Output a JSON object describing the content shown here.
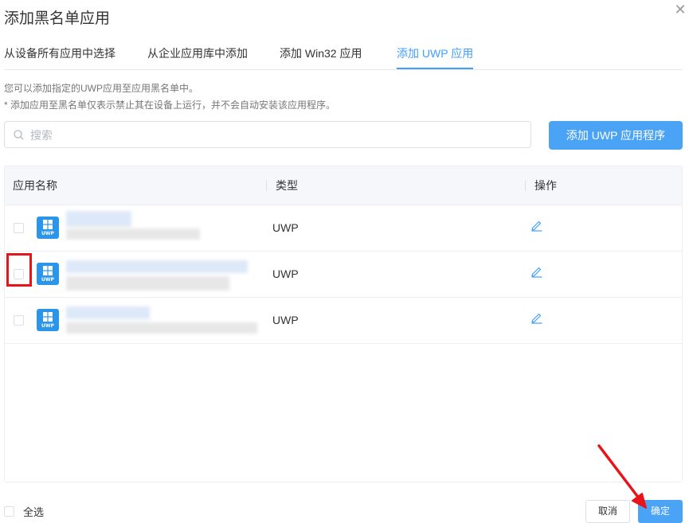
{
  "dialog": {
    "title": "添加黑名单应用"
  },
  "tabs": [
    {
      "label": "从设备所有应用中选择"
    },
    {
      "label": "从企业应用库中添加"
    },
    {
      "label": "添加 Win32 应用"
    },
    {
      "label": "添加 UWP 应用"
    }
  ],
  "active_tab_index": 3,
  "tips": {
    "line1": "您可以添加指定的UWP应用至应用黑名单中。",
    "line2": "* 添加应用至黑名单仅表示禁止其在设备上运行，并不会自动安装该应用程序。"
  },
  "search": {
    "placeholder": "搜索",
    "value": ""
  },
  "add_button": {
    "label": "添加 UWP 应用程序"
  },
  "table": {
    "columns": {
      "name": "应用名称",
      "type": "类型",
      "action": "操作"
    },
    "rows": [
      {
        "name": "",
        "publisher": "",
        "type": "UWP",
        "icon_badge": "UWP",
        "checked": false
      },
      {
        "name": "",
        "publisher": "",
        "type": "UWP",
        "icon_badge": "UWP",
        "checked": false
      },
      {
        "name": "",
        "publisher": "",
        "type": "UWP",
        "icon_badge": "UWP",
        "checked": false
      }
    ]
  },
  "footer": {
    "select_all_label": "全选",
    "cancel_label": "取消",
    "ok_label": "确定"
  },
  "colors": {
    "accent": "#409eff",
    "primary_button": "#4aa3f5",
    "annotation_red": "#e8141a",
    "app_icon": "#2b95e9"
  },
  "icons": {
    "close": "close-icon",
    "search": "search-icon",
    "app": "windows-logo-icon",
    "edit": "pencil-edit-icon"
  }
}
